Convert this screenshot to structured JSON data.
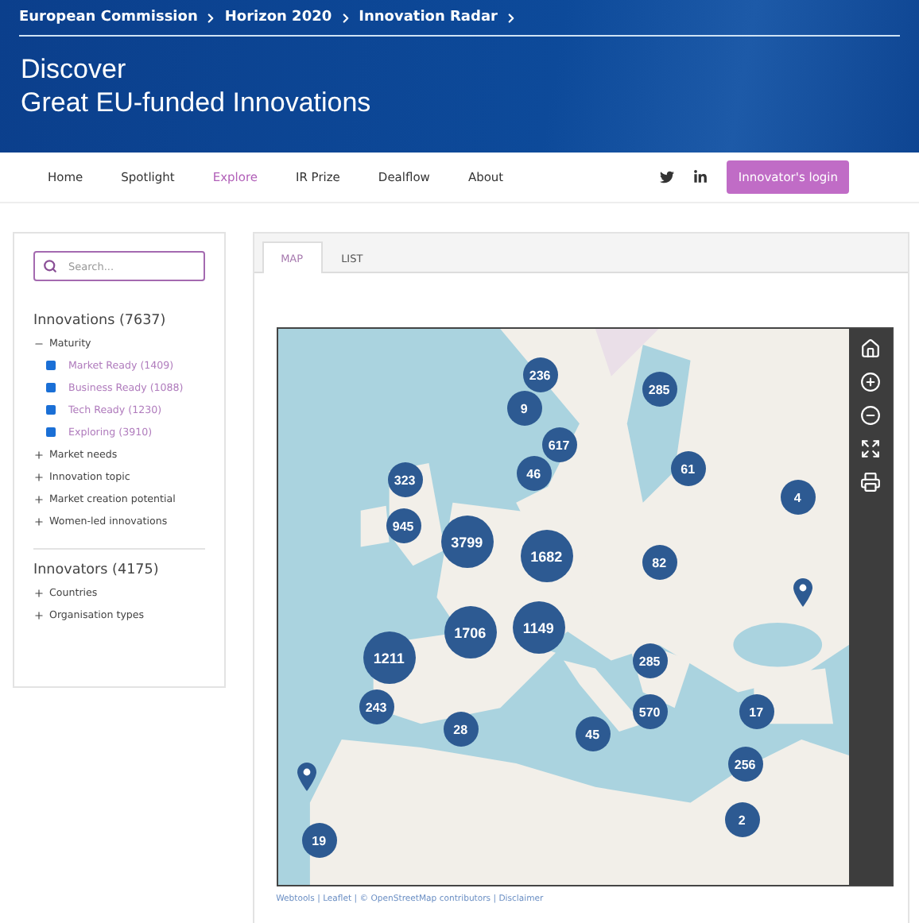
{
  "breadcrumb": [
    "European Commission",
    "Horizon 2020",
    "Innovation Radar"
  ],
  "hero": {
    "title_lines": [
      "Discover",
      "Great EU-funded Innovations"
    ]
  },
  "nav": {
    "items": [
      {
        "label": "Home",
        "selected": false
      },
      {
        "label": "Spotlight",
        "selected": false
      },
      {
        "label": "Explore",
        "selected": true
      },
      {
        "label": "IR Prize",
        "selected": false
      },
      {
        "label": "Dealflow",
        "selected": false
      },
      {
        "label": "About",
        "selected": false
      }
    ],
    "login_button": "Innovator's login"
  },
  "sidebar": {
    "search": {
      "placeholder": "Search..."
    },
    "innovations": {
      "title": "Innovations (7637)",
      "groups": [
        {
          "label": "Maturity",
          "expanded": true,
          "children": [
            {
              "label": "Market Ready (1409)",
              "checked": true
            },
            {
              "label": "Business Ready (1088)",
              "checked": true
            },
            {
              "label": "Tech Ready (1230)",
              "checked": true
            },
            {
              "label": "Exploring (3910)",
              "checked": true
            }
          ]
        },
        {
          "label": "Market needs",
          "expanded": false
        },
        {
          "label": "Innovation topic",
          "expanded": false
        },
        {
          "label": "Market creation potential",
          "expanded": false
        },
        {
          "label": "Women-led innovations",
          "expanded": false
        }
      ]
    },
    "innovators": {
      "title": "Innovators (4175)",
      "groups": [
        {
          "label": "Countries",
          "expanded": false
        },
        {
          "label": "Organisation types",
          "expanded": false
        }
      ]
    }
  },
  "tabs": [
    {
      "label": "MAP",
      "selected": true
    },
    {
      "label": "LIST",
      "selected": false
    }
  ],
  "map": {
    "markers": [
      {
        "kind": "cluster",
        "label": "236"
      },
      {
        "kind": "cluster",
        "label": "9"
      },
      {
        "kind": "cluster",
        "label": "617"
      },
      {
        "kind": "cluster",
        "label": "46"
      },
      {
        "kind": "cluster",
        "label": "323"
      },
      {
        "kind": "cluster",
        "label": "285"
      },
      {
        "kind": "cluster",
        "label": "61"
      },
      {
        "kind": "cluster",
        "label": "4"
      },
      {
        "kind": "cluster",
        "label": "945"
      },
      {
        "kind": "cluster_large",
        "label": "3799"
      },
      {
        "kind": "cluster_large",
        "label": "1682"
      },
      {
        "kind": "cluster",
        "label": "82"
      },
      {
        "kind": "pin"
      },
      {
        "kind": "cluster_large",
        "label": "1706"
      },
      {
        "kind": "cluster_large",
        "label": "1149"
      },
      {
        "kind": "cluster_large",
        "label": "1211"
      },
      {
        "kind": "cluster",
        "label": "285"
      },
      {
        "kind": "cluster",
        "label": "243"
      },
      {
        "kind": "cluster",
        "label": "28"
      },
      {
        "kind": "cluster",
        "label": "45"
      },
      {
        "kind": "cluster",
        "label": "570"
      },
      {
        "kind": "cluster",
        "label": "17"
      },
      {
        "kind": "cluster",
        "label": "256"
      },
      {
        "kind": "cluster",
        "label": "2"
      },
      {
        "kind": "pin"
      },
      {
        "kind": "cluster",
        "label": "19"
      }
    ],
    "attribution": "Webtools | Leaflet | © OpenStreetMap contributors | Disclaimer"
  }
}
